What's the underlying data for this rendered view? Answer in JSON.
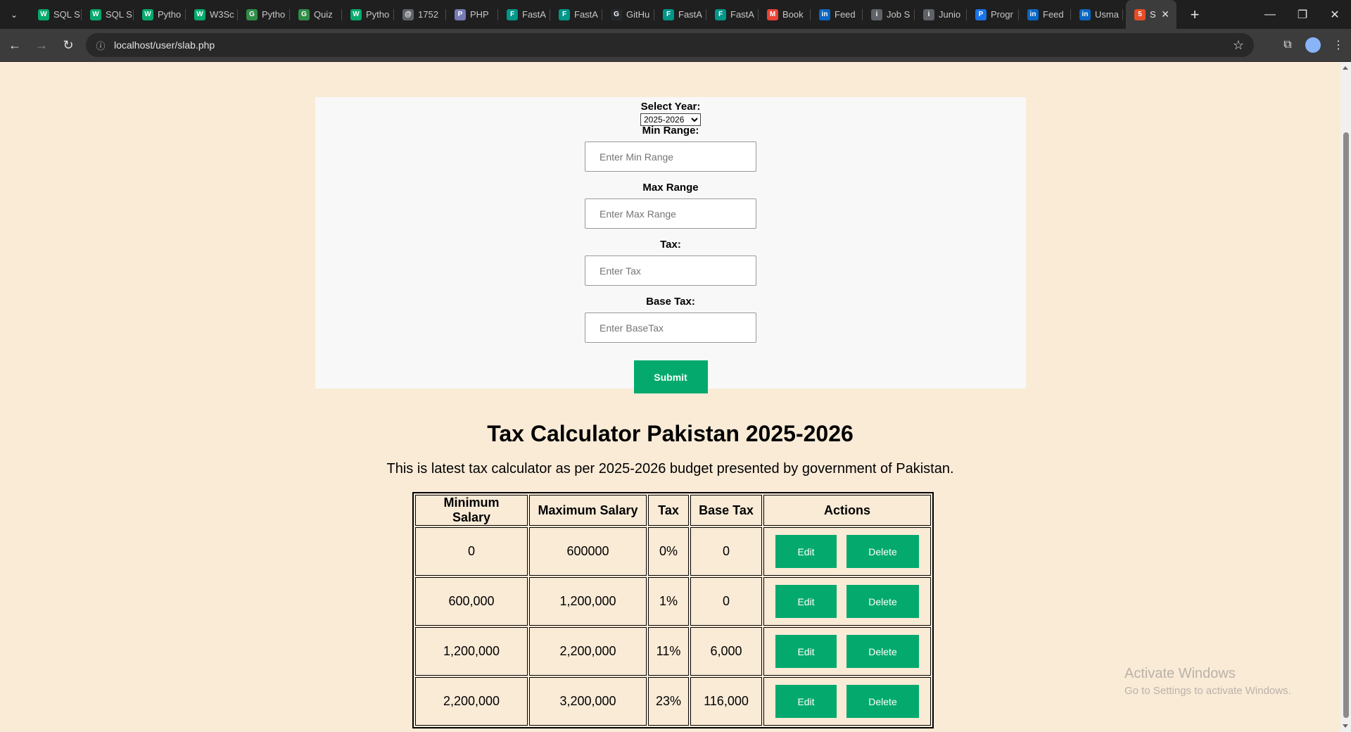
{
  "browser": {
    "tabs": [
      {
        "label": "SQL S",
        "icon": "w3schools-icon",
        "color": "#04aa6d",
        "glyph": "W"
      },
      {
        "label": "SQL S",
        "icon": "w3schools-icon",
        "color": "#04aa6d",
        "glyph": "W"
      },
      {
        "label": "Pytho",
        "icon": "w3schools-icon",
        "color": "#04aa6d",
        "glyph": "W"
      },
      {
        "label": "W3Sc",
        "icon": "w3schools-icon",
        "color": "#04aa6d",
        "glyph": "W"
      },
      {
        "label": "Pytho",
        "icon": "geeksforgeeks-icon",
        "color": "#2f8d46",
        "glyph": "G"
      },
      {
        "label": "Quiz",
        "icon": "geeksforgeeks-icon",
        "color": "#2f8d46",
        "glyph": "G"
      },
      {
        "label": "Pytho",
        "icon": "w3schools-icon",
        "color": "#04aa6d",
        "glyph": "W"
      },
      {
        "label": "1752",
        "icon": "link-icon",
        "color": "#5f6368",
        "glyph": "@"
      },
      {
        "label": "PHP",
        "icon": "php-icon",
        "color": "#777bb4",
        "glyph": "P"
      },
      {
        "label": "FastA",
        "icon": "fastapi-icon",
        "color": "#009688",
        "glyph": "F"
      },
      {
        "label": "FastA",
        "icon": "fastapi-icon",
        "color": "#009688",
        "glyph": "F"
      },
      {
        "label": "GitHu",
        "icon": "github-icon",
        "color": "#24292e",
        "glyph": "G"
      },
      {
        "label": "FastA",
        "icon": "fastapi-icon",
        "color": "#009688",
        "glyph": "F"
      },
      {
        "label": "FastA",
        "icon": "fastapi-icon",
        "color": "#009688",
        "glyph": "F"
      },
      {
        "label": "Book",
        "icon": "gmail-icon",
        "color": "#ea4335",
        "glyph": "M"
      },
      {
        "label": "Feed",
        "icon": "linkedin-icon",
        "color": "#0a66c2",
        "glyph": "in"
      },
      {
        "label": "Job S",
        "icon": "info-icon",
        "color": "#5f6368",
        "glyph": "i"
      },
      {
        "label": "Junio",
        "icon": "info-icon",
        "color": "#5f6368",
        "glyph": "i"
      },
      {
        "label": "Progr",
        "icon": "shield-icon",
        "color": "#1a73e8",
        "glyph": "P"
      },
      {
        "label": "Feed",
        "icon": "linkedin-icon",
        "color": "#0a66c2",
        "glyph": "in"
      },
      {
        "label": "Usma",
        "icon": "linkedin-icon",
        "color": "#0a66c2",
        "glyph": "in"
      }
    ],
    "active_tab": {
      "label": "S",
      "icon": "html-icon",
      "color": "#e44d26"
    },
    "url": "localhost/user/slab.php"
  },
  "form": {
    "year_label": "Select Year:",
    "year_value": "2025-2026",
    "min_label": "Min Range:",
    "min_placeholder": "Enter Min Range",
    "max_label": "Max Range",
    "max_placeholder": "Enter Max Range",
    "tax_label": "Tax:",
    "tax_placeholder": "Enter Tax",
    "base_label": "Base Tax:",
    "base_placeholder": "Enter BaseTax",
    "submit_label": "Submit"
  },
  "page": {
    "title": "Tax Calculator Pakistan 2025-2026",
    "description": "This is latest tax calculator as per 2025-2026 budget presented by government of Pakistan."
  },
  "table": {
    "headers": [
      "Minimum Salary",
      "Maximum Salary",
      "Tax",
      "Base Tax",
      "Actions"
    ],
    "rows": [
      {
        "min": "0",
        "max": "600000",
        "tax": "0%",
        "base": "0"
      },
      {
        "min": "600,000",
        "max": "1,200,000",
        "tax": "1%",
        "base": "0"
      },
      {
        "min": "1,200,000",
        "max": "2,200,000",
        "tax": "11%",
        "base": "6,000"
      },
      {
        "min": "2,200,000",
        "max": "3,200,000",
        "tax": "23%",
        "base": "116,000"
      }
    ],
    "edit_label": "Edit",
    "delete_label": "Delete"
  },
  "watermark": {
    "line1": "Activate Windows",
    "line2": "Go to Settings to activate Windows."
  },
  "colors": {
    "accent": "#04aa6d",
    "page_bg": "#faebd7",
    "form_bg": "#f8f8f8"
  }
}
